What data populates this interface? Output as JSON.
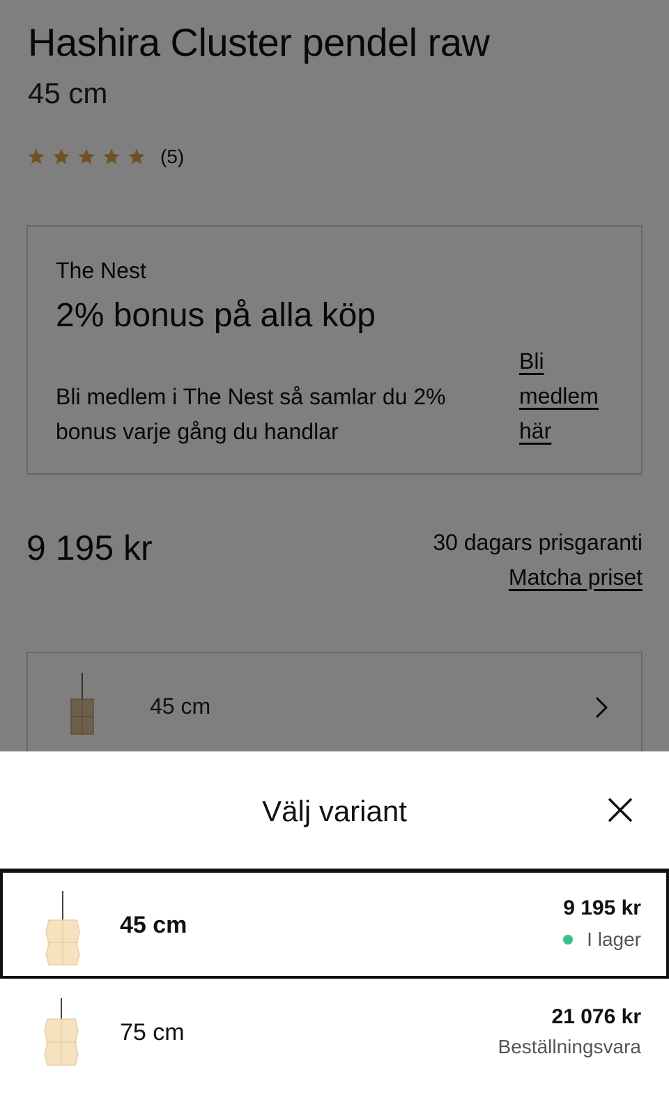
{
  "product": {
    "title": "Hashira Cluster pendel raw",
    "size": "45 cm",
    "rating_stars": 5,
    "rating_count": "(5)"
  },
  "promo": {
    "label": "The Nest",
    "headline": "2% bonus på alla köp",
    "body": "Bli medlem i The Nest så samlar du 2% bonus varje gång du handlar",
    "link": "Bli medlem här"
  },
  "pricing": {
    "price": "9 195 kr",
    "guarantee": "30 dagars prisgaranti",
    "match_link": "Matcha priset"
  },
  "variant_selector": {
    "label": "45 cm",
    "icon": "chevron-right-icon"
  },
  "sheet": {
    "title": "Välj variant",
    "close_icon": "close-icon",
    "variants": [
      {
        "label": "45 cm",
        "price": "9 195 kr",
        "status": "I lager",
        "status_color": "#3cc08a",
        "selected": true
      },
      {
        "label": "75 cm",
        "price": "21 076 kr",
        "status": "Beställningsvara",
        "selected": false
      }
    ]
  },
  "colors": {
    "star": "#e0a34a",
    "overlay": "rgba(0,0,0,0.5)",
    "promo_border": "#d9cbb6",
    "in_stock": "#3cc08a"
  }
}
